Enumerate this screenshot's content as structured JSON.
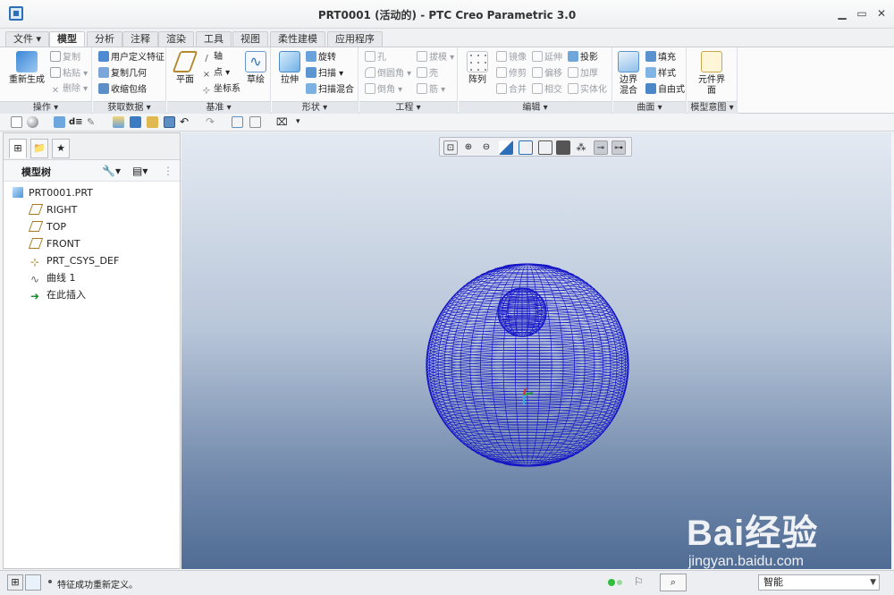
{
  "window": {
    "title": "PRT0001 (活动的) - PTC Creo Parametric 3.0",
    "controls": [
      "▁",
      "▭",
      "✕"
    ]
  },
  "menu": {
    "tabs": [
      "文件",
      "模型",
      "分析",
      "注释",
      "渲染",
      "工具",
      "视图",
      "柔性建模",
      "应用程序"
    ],
    "active": "模型"
  },
  "ribbon": {
    "operations": {
      "label": "操作",
      "regenerate": "重新生成",
      "copy": "复制",
      "paste": "粘贴",
      "delete": "删除"
    },
    "get_data": {
      "label": "获取数据",
      "user_feature": "用户定义特征",
      "copy_geometry": "复制几何",
      "shrinkwrap": "收缩包络"
    },
    "datum": {
      "label": "基准",
      "plane": "平面",
      "axis": "轴",
      "point": "点",
      "csys": "坐标系",
      "sketch": "草绘"
    },
    "shapes": {
      "label": "形状",
      "extrude": "拉伸",
      "revolve": "旋转",
      "sweep": "扫描",
      "swept_blend": "扫描混合"
    },
    "engineering": {
      "label": "工程",
      "hole": "孔",
      "round": "倒圆角",
      "chamfer": "倒角",
      "draft": "拔模",
      "shell": "壳",
      "rib": "筋"
    },
    "editing": {
      "label": "编辑",
      "pattern": "阵列",
      "mirror": "镜像",
      "trim": "修剪",
      "merge": "合并",
      "extend": "延伸",
      "offset": "偏移",
      "intersect": "相交",
      "project": "投影",
      "thicken": "加厚",
      "solidify": "实体化"
    },
    "surfaces": {
      "label": "曲面",
      "boundary_blend": "边界混合",
      "fill": "填充",
      "style": "样式",
      "freestyle": "自由式"
    },
    "model_intent": {
      "label": "模型意图",
      "component_interface": "元件界面"
    }
  },
  "model_tree": {
    "header": "模型树",
    "items": [
      "PRT0001.PRT",
      "RIGHT",
      "TOP",
      "FRONT",
      "PRT_CSYS_DEF",
      "曲线 1",
      "在此插入"
    ]
  },
  "watermark": {
    "brand": "Bai经验",
    "url": "jingyan.baidu.com"
  },
  "status": {
    "message": "特征成功重新定义。",
    "filter": "智能"
  },
  "colors": {
    "wireframe": "#1515c8",
    "viewport_top": "#e4eaf2",
    "viewport_bottom": "#506c94"
  }
}
